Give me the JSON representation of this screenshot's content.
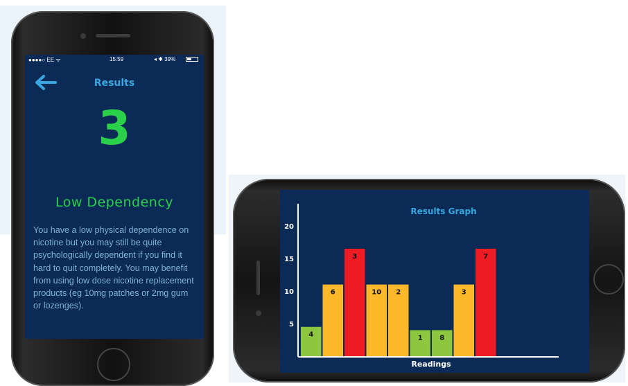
{
  "portrait": {
    "status": {
      "carrier": "●●●●○ EE ᯤ",
      "time": "15:59",
      "battery_text": "◂ ✱ 39%",
      "battery_level": 0.39
    },
    "title": "Results",
    "score": "3",
    "level": "Low Dependency",
    "description": "You have a low physical dependence on nicotine but you may still be quite psychologically dependent if you find it hard to quit completely. You may benefit from using low dose nicotine replacement products (eg 10mg patches or 2mg gum or lozenges).",
    "colors": {
      "background": "#0b2a55",
      "title": "#37a8e0",
      "score": "#2bd04a",
      "text": "#7fb2d8"
    }
  },
  "chart_data": {
    "type": "bar",
    "title": "Results Graph",
    "xlabel": "Readings",
    "ylabel": "",
    "yticks": [
      5,
      10,
      15,
      20
    ],
    "ylim": [
      0,
      22
    ],
    "categories": [
      "4",
      "6",
      "3",
      "10",
      "2",
      "1",
      "8",
      "3",
      "7"
    ],
    "values": [
      4.5,
      11,
      16.5,
      11,
      11,
      4,
      4,
      11,
      16.5
    ],
    "colors": [
      "#8dc63f",
      "#fbb829",
      "#ed1c24",
      "#fbb829",
      "#fbb829",
      "#8dc63f",
      "#8dc63f",
      "#fbb829",
      "#ed1c24"
    ]
  }
}
